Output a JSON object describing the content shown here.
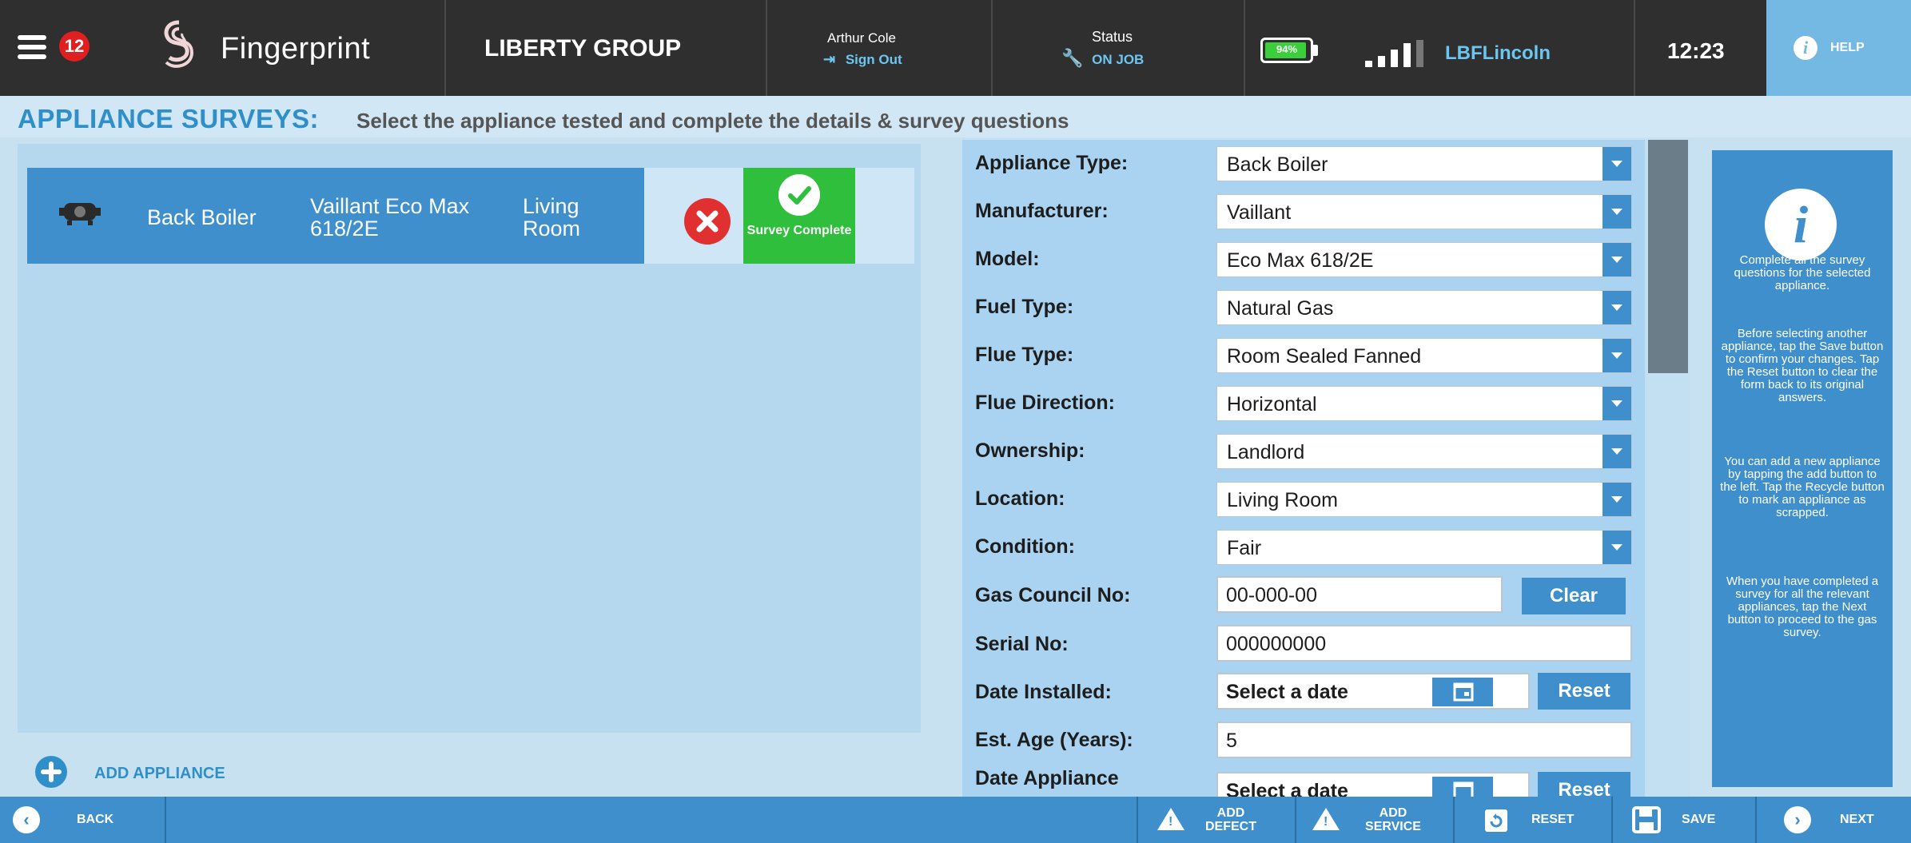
{
  "header": {
    "notification_count": "12",
    "brand": "Fingerprint",
    "company": "LIBERTY GROUP",
    "user_name": "Arthur Cole",
    "sign_out": "Sign Out",
    "status_label": "Status",
    "status_value": "ON JOB",
    "battery": "94%",
    "battery_level": 0.94,
    "network": "LBFLincoln",
    "time": "12:23",
    "help": "HELP"
  },
  "page": {
    "title": "APPLIANCE SURVEYS:",
    "subtitle": "Select the appliance tested and complete the details & survey questions"
  },
  "appliances": [
    {
      "type": "Back Boiler",
      "model": "Vaillant Eco Max 618/2E",
      "location": "Living Room",
      "status": "Survey Complete"
    }
  ],
  "add_appliance": "ADD APPLIANCE",
  "form": {
    "appliance_type": {
      "label": "Appliance Type:",
      "value": "Back Boiler"
    },
    "manufacturer": {
      "label": "Manufacturer:",
      "value": "Vaillant"
    },
    "model": {
      "label": "Model:",
      "value": "Eco Max 618/2E"
    },
    "fuel_type": {
      "label": "Fuel Type:",
      "value": "Natural Gas"
    },
    "flue_type": {
      "label": "Flue Type:",
      "value": "Room Sealed Fanned"
    },
    "flue_direction": {
      "label": "Flue Direction:",
      "value": "Horizontal"
    },
    "ownership": {
      "label": "Ownership:",
      "value": "Landlord"
    },
    "location": {
      "label": "Location:",
      "value": "Living Room"
    },
    "condition": {
      "label": "Condition:",
      "value": "Fair"
    },
    "gas_council_no": {
      "label": "Gas Council No:",
      "value": "00-000-00",
      "button": "Clear"
    },
    "serial_no": {
      "label": "Serial No:",
      "value": "000000000"
    },
    "date_installed": {
      "label": "Date Installed:",
      "value": "Select a date",
      "button": "Reset"
    },
    "est_age": {
      "label": "Est. Age (Years):",
      "value": "5"
    },
    "date_appliance": {
      "label": "Date Appliance",
      "value": "Select a date",
      "button": "Reset"
    }
  },
  "info": {
    "p1": "Complete all the survey questions for the selected appliance.",
    "p2": "Before selecting another appliance, tap the Save button to confirm your changes. Tap the Reset button to clear the form back to its original answers.",
    "p3": "You can add a new appliance by tapping the add button to the left. Tap the Recycle button to mark an appliance as scrapped.",
    "p4": "When you have completed a survey for all the relevant appliances, tap the Next button to proceed to the gas survey."
  },
  "footer": {
    "back": "BACK",
    "add_defect_1": "ADD",
    "add_defect_2": "DEFECT",
    "add_service_1": "ADD",
    "add_service_2": "SERVICE",
    "reset": "RESET",
    "save": "SAVE",
    "next": "NEXT"
  }
}
